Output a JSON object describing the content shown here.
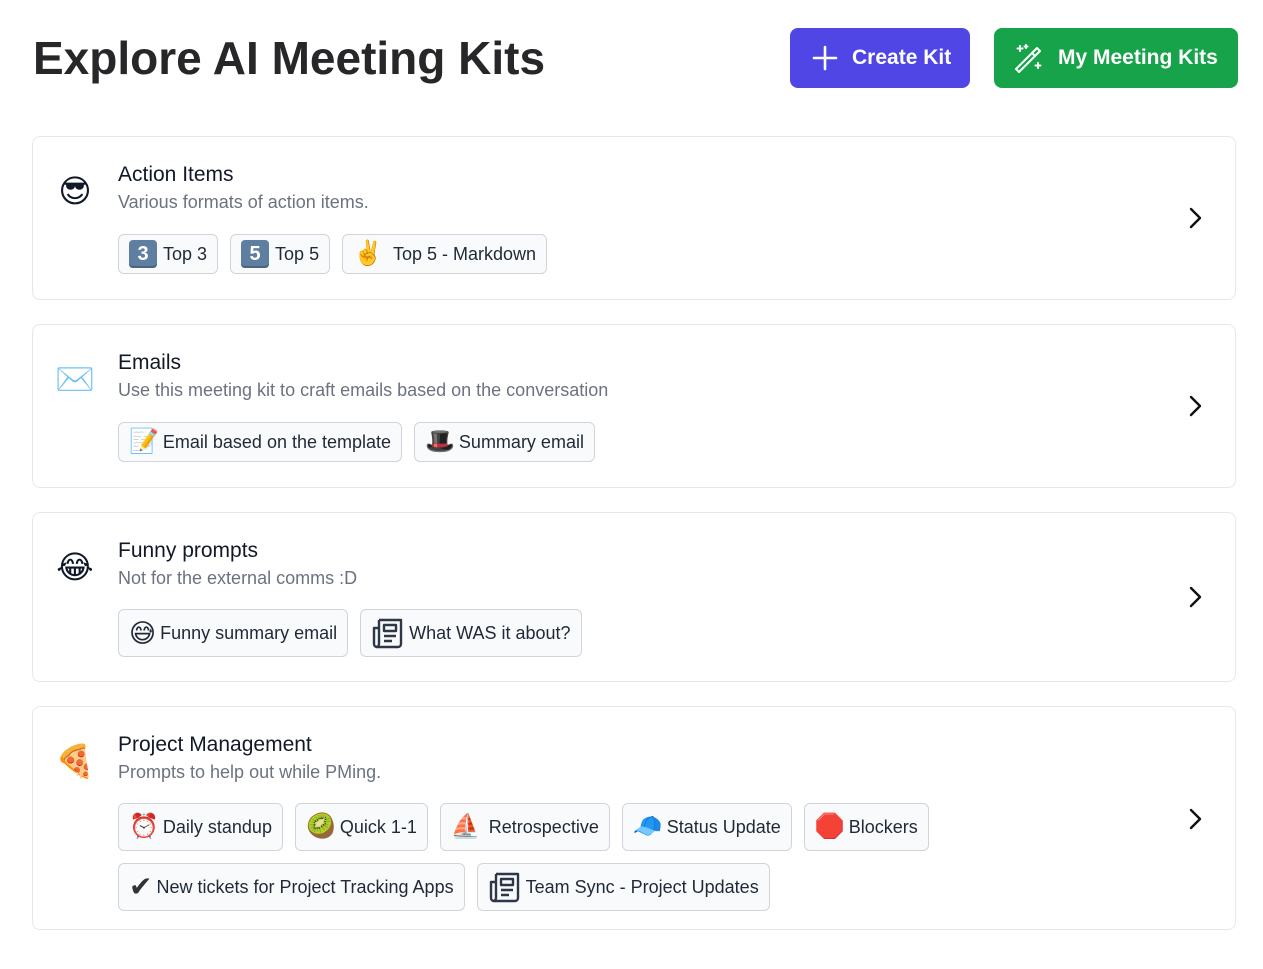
{
  "header": {
    "title": "Explore AI Meeting Kits",
    "create_button": "Create Kit",
    "my_kits_button": "My Meeting Kits",
    "colors": {
      "create": "#4f46e5",
      "my_kits": "#16a34a"
    }
  },
  "kits": [
    {
      "emoji": "😎",
      "title": "Action Items",
      "description": "Various formats of action items.",
      "prompts": [
        {
          "icon": "3",
          "label": "Top 3"
        },
        {
          "icon": "5",
          "label": "Top 5"
        },
        {
          "icon": "✌️",
          "label": "Top 5 - Markdown"
        }
      ]
    },
    {
      "emoji": "✉️",
      "title": "Emails",
      "description": "Use this meeting kit to craft emails based on the conversation",
      "prompts": [
        {
          "icon": "📝",
          "label": "Email based on the template"
        },
        {
          "icon": "🎩",
          "label": "Summary email"
        }
      ]
    },
    {
      "emoji": "😂",
      "title": "Funny prompts",
      "description": "Not for the external comms :D",
      "prompts": [
        {
          "icon": "😅",
          "label": "Funny summary email"
        },
        {
          "icon": "newspaper",
          "label": "What WAS it about?"
        }
      ]
    },
    {
      "emoji": "🍕",
      "title": "Project Management",
      "description": "Prompts to help out while PMing.",
      "prompts": [
        {
          "icon": "⏰",
          "label": "Daily standup"
        },
        {
          "icon": "🥝",
          "label": "Quick 1-1"
        },
        {
          "icon": "⛵",
          "label": "Retrospective"
        },
        {
          "icon": "🧢",
          "label": "Status Update"
        },
        {
          "icon": "🛑",
          "label": "Blockers"
        },
        {
          "icon": "✔",
          "label": "New tickets for Project Tracking Apps"
        },
        {
          "icon": "newspaper",
          "label": "Team Sync - Project Updates"
        }
      ]
    }
  ]
}
